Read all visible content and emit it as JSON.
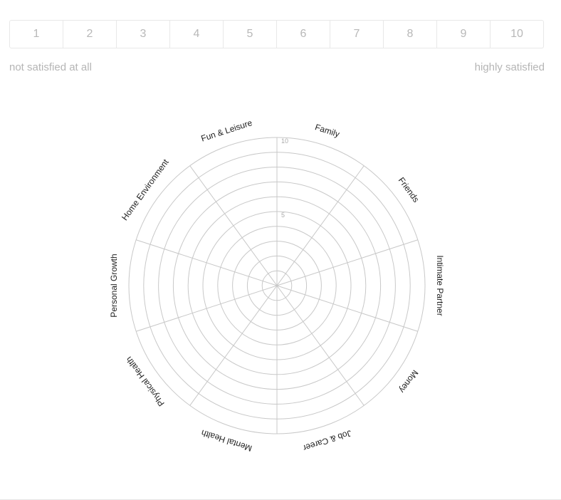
{
  "rating_scale": {
    "options": [
      "1",
      "2",
      "3",
      "4",
      "5",
      "6",
      "7",
      "8",
      "9",
      "10"
    ],
    "min_label": "not satisfied at all",
    "max_label": "highly satisfied"
  },
  "wheel": {
    "max_value": 10,
    "ring_count": 10,
    "ring_labels": [
      "10",
      "5"
    ],
    "categories": [
      "Family",
      "Friends",
      "Intimate Partner",
      "Money",
      "Job & Career",
      "Mental Health",
      "Physical Health",
      "Personal Growth",
      "Home Environment",
      "Fun & Leisure"
    ],
    "colors": {
      "grid": "#c8c8c8",
      "label": "#222222",
      "ring_label": "#aaaaaa"
    }
  }
}
